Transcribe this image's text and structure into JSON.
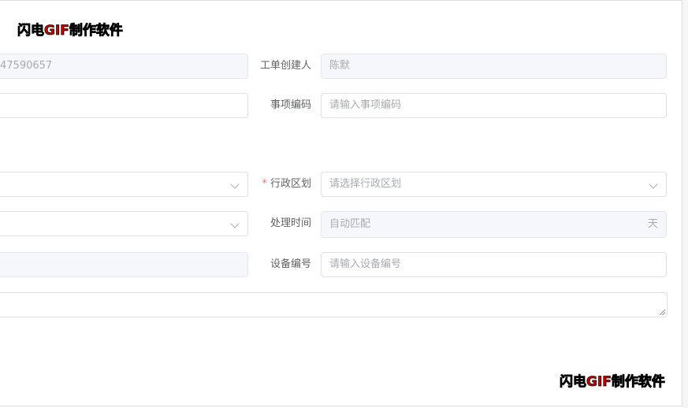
{
  "watermark": {
    "part1": "闪电GIF",
    "part2": "制作软件"
  },
  "form": {
    "ticket_no_value": "47590657",
    "creator_label": "工单创建人",
    "creator_value": "陈默",
    "item_code_label": "事项编码",
    "item_code_placeholder": "请输入事项编码",
    "admin_region_required": "*",
    "admin_region_label": "行政区划",
    "admin_region_placeholder": "请选择行政区划",
    "process_time_label": "处理时间",
    "process_time_value": "自动匹配",
    "process_time_unit": "天",
    "device_code_label": "设备编号",
    "device_code_placeholder": "请输入设备编号"
  }
}
